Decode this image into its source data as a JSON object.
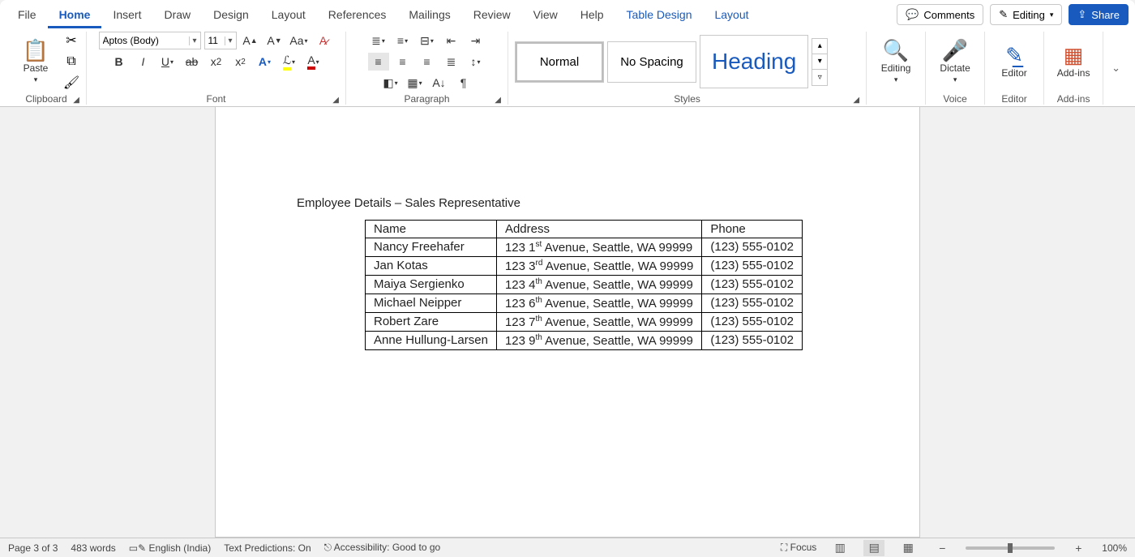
{
  "tabs": {
    "file": "File",
    "home": "Home",
    "insert": "Insert",
    "draw": "Draw",
    "design": "Design",
    "layout": "Layout",
    "references": "References",
    "mailings": "Mailings",
    "review": "Review",
    "view": "View",
    "help": "Help",
    "tabledesign": "Table Design",
    "tablelayout": "Layout"
  },
  "topright": {
    "comments": "Comments",
    "editing": "Editing",
    "share": "Share"
  },
  "ribbon": {
    "clipboard": {
      "paste": "Paste",
      "label": "Clipboard"
    },
    "font": {
      "fontname": "Aptos (Body)",
      "fontsize": "11",
      "label": "Font"
    },
    "paragraph": {
      "label": "Paragraph"
    },
    "styles": {
      "normal": "Normal",
      "nospacing": "No Spacing",
      "heading": "Heading",
      "label": "Styles"
    },
    "editing": {
      "btn": "Editing"
    },
    "voice": {
      "btn": "Dictate",
      "label": "Voice"
    },
    "editor": {
      "btn": "Editor",
      "label": "Editor"
    },
    "addins": {
      "btn": "Add-ins",
      "label": "Add-ins"
    }
  },
  "document": {
    "heading": "Employee Details – Sales Representative",
    "headers": {
      "name": "Name",
      "address": "Address",
      "phone": "Phone"
    },
    "rows": [
      {
        "name": "Nancy Freehafer",
        "addr_a": "123 1",
        "addr_sup": "st",
        "addr_b": " Avenue, Seattle, WA 99999",
        "phone": "(123) 555-0102"
      },
      {
        "name": "Jan Kotas",
        "addr_a": "123 3",
        "addr_sup": "rd",
        "addr_b": " Avenue, Seattle, WA 99999",
        "phone": "(123) 555-0102"
      },
      {
        "name": "Maiya Sergienko",
        "addr_a": "123 4",
        "addr_sup": "th",
        "addr_b": " Avenue, Seattle, WA 99999",
        "phone": "(123) 555-0102"
      },
      {
        "name": "Michael Neipper",
        "addr_a": "123 6",
        "addr_sup": "th",
        "addr_b": " Avenue, Seattle, WA 99999",
        "phone": "(123) 555-0102"
      },
      {
        "name": "Robert Zare",
        "addr_a": "123 7",
        "addr_sup": "th",
        "addr_b": " Avenue, Seattle, WA 99999",
        "phone": "(123) 555-0102"
      },
      {
        "name": "Anne Hullung-Larsen",
        "addr_a": "123 9",
        "addr_sup": "th",
        "addr_b": " Avenue, Seattle, WA 99999",
        "phone": "(123) 555-0102"
      }
    ]
  },
  "status": {
    "page": "Page 3 of 3",
    "words": "483 words",
    "lang": "English (India)",
    "pred": "Text Predictions: On",
    "acc": "Accessibility: Good to go",
    "focus": "Focus",
    "zoom": "100%"
  }
}
